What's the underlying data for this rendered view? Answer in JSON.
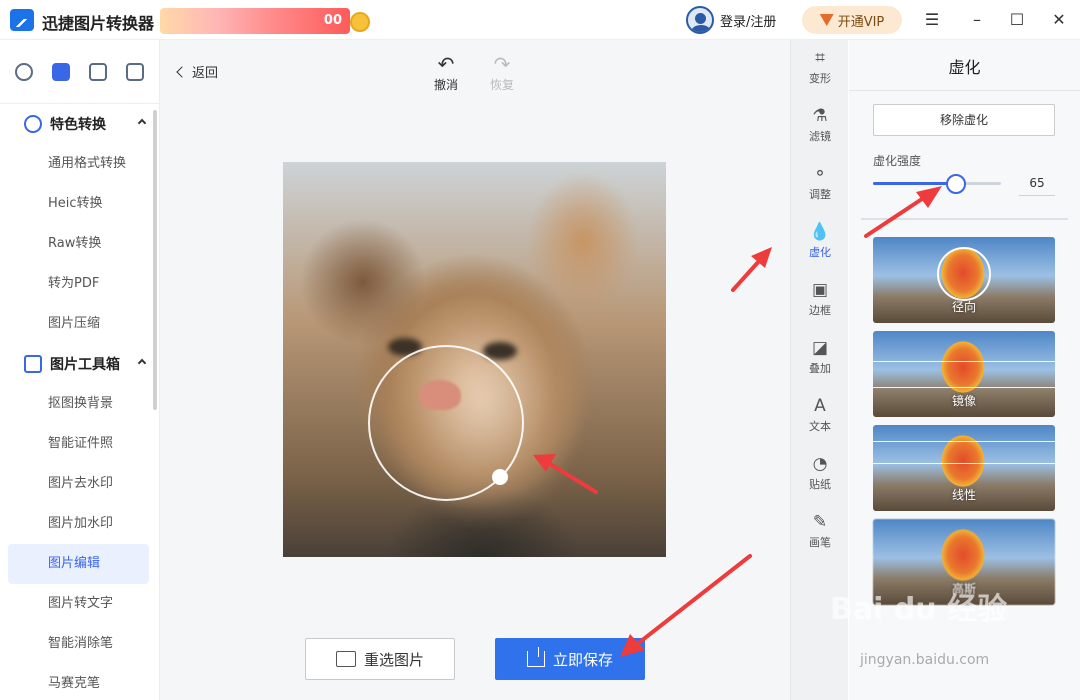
{
  "app": {
    "title": "迅捷图片转换器",
    "promo_text": "00",
    "login_label": "登录/注册",
    "vip_label": "开通VIP"
  },
  "window_controls": {
    "menu": "☰",
    "minimize": "–",
    "maximize": "☐",
    "close": "✕"
  },
  "sidebar": {
    "groups": [
      {
        "label": "特色转换",
        "items": [
          "通用格式转换",
          "Heic转换",
          "Raw转换",
          "转为PDF",
          "图片压缩"
        ]
      },
      {
        "label": "图片工具箱",
        "items": [
          "抠图换背景",
          "智能证件照",
          "图片去水印",
          "图片加水印",
          "图片编辑",
          "图片转文字",
          "智能消除笔",
          "马赛克笔"
        ]
      }
    ],
    "active_item": "图片编辑"
  },
  "toolbar": {
    "back_label": "返回",
    "undo_label": "撤消",
    "redo_label": "恢复"
  },
  "actions": {
    "reselect_label": "重选图片",
    "save_label": "立即保存"
  },
  "tools": [
    {
      "label": "变形",
      "icon": "crop-icon",
      "glyph": "⌗"
    },
    {
      "label": "滤镜",
      "icon": "filter-icon",
      "glyph": "⚗"
    },
    {
      "label": "调整",
      "icon": "adjust-icon",
      "glyph": "⚬"
    },
    {
      "label": "虚化",
      "icon": "blur-drop-icon",
      "glyph": "💧"
    },
    {
      "label": "边框",
      "icon": "frame-icon",
      "glyph": "▣"
    },
    {
      "label": "叠加",
      "icon": "overlay-icon",
      "glyph": "◪"
    },
    {
      "label": "文本",
      "icon": "text-icon",
      "glyph": "A"
    },
    {
      "label": "贴纸",
      "icon": "sticker-icon",
      "glyph": "◔"
    },
    {
      "label": "画笔",
      "icon": "brush-icon",
      "glyph": "✎"
    }
  ],
  "active_tool": "虚化",
  "blur_panel": {
    "title": "虚化",
    "remove_label": "移除虚化",
    "strength_label": "虚化强度",
    "strength_value": "65",
    "strength_fraction": 0.65,
    "presets": [
      "径向",
      "镜像",
      "线性",
      "高斯"
    ]
  },
  "watermark": {
    "brand": "Bai du 经验",
    "url": "jingyan.baidu.com"
  },
  "colors": {
    "accent": "#3a66e8",
    "save_button": "#3071ec",
    "annotation_arrow": "#ee3b3b"
  }
}
